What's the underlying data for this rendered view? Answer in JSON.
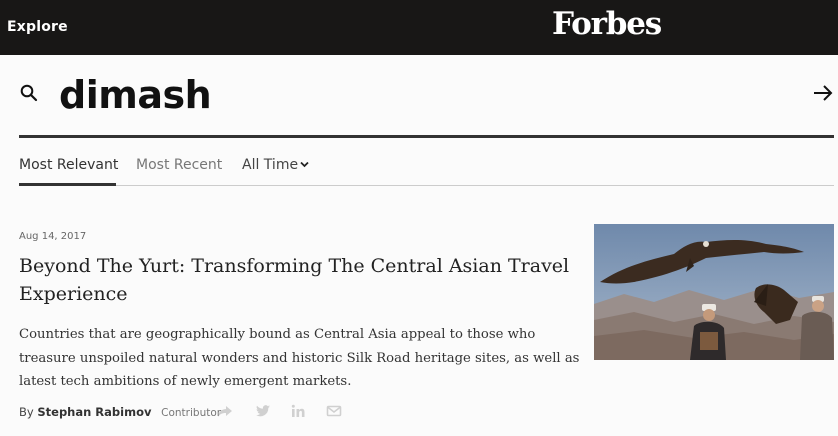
{
  "header": {
    "explore_label": "Explore",
    "logo_text": "Forbes",
    "background": "#181716"
  },
  "search": {
    "query": "dimash",
    "icon": "search-icon",
    "submit_icon": "arrow-right-icon"
  },
  "tabs": [
    {
      "label": "Most Relevant",
      "active": true
    },
    {
      "label": "Most Recent",
      "active": false
    },
    {
      "label": "All Time",
      "active": false,
      "dropdown": true
    }
  ],
  "results": [
    {
      "date": "Aug 14, 2017",
      "title": "Beyond The Yurt: Transforming The Central Asian Travel Experience",
      "description": "Countries that are geographically bound as Central Asia appeal to those who treasure unspoiled natural wonders and historic Silk Road heritage sites, as well as latest tech ambitions of newly emergent markets.",
      "by_label": "By",
      "author": "Stephan Rabimov",
      "author_role": "Contributor",
      "share_icons": [
        "share-icon",
        "twitter-icon",
        "linkedin-icon",
        "email-icon"
      ],
      "image": "eagle-hunters-photo"
    }
  ]
}
